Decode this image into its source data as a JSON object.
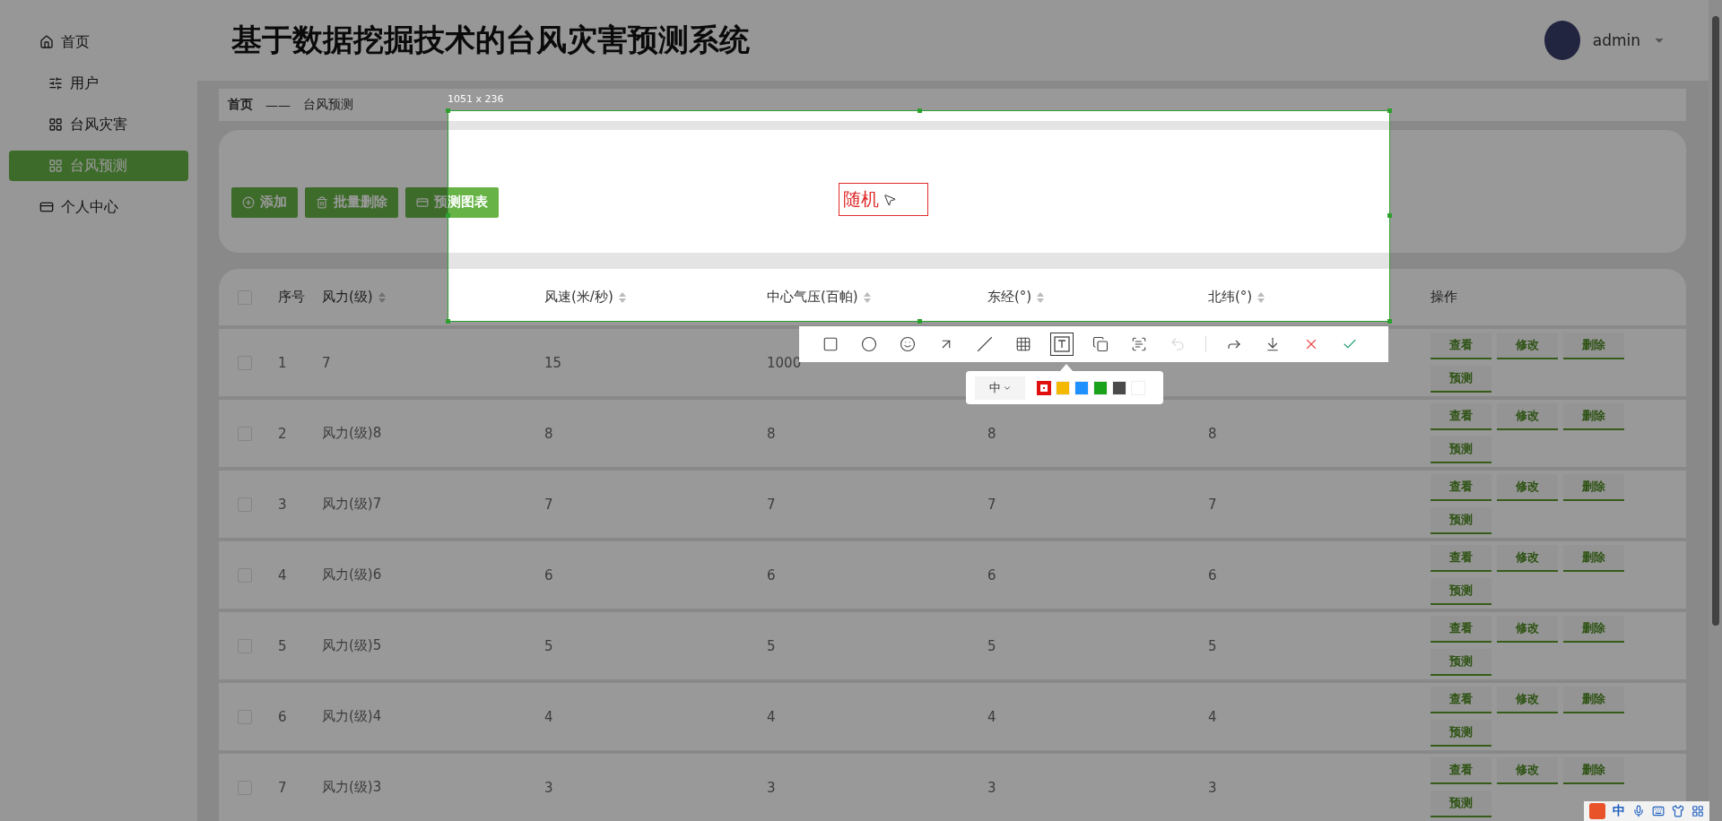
{
  "sidebar": {
    "items": [
      {
        "label": "首页",
        "kind": "top",
        "selected": false
      },
      {
        "label": "用户",
        "kind": "sub",
        "selected": false
      },
      {
        "label": "台风灾害",
        "kind": "sub",
        "selected": false
      },
      {
        "label": "台风预测",
        "kind": "sub",
        "selected": true
      },
      {
        "label": "个人中心",
        "kind": "top",
        "selected": false
      }
    ]
  },
  "header": {
    "title": "基于数据挖掘技术的台风灾害预测系统",
    "user": "admin"
  },
  "breadcrumb": {
    "items": [
      "首页",
      "台风预测"
    ],
    "separator": "——"
  },
  "actions": [
    {
      "label": "添加",
      "kind": "add"
    },
    {
      "label": "批量删除",
      "kind": "delete"
    },
    {
      "label": "预测图表",
      "kind": "chart"
    }
  ],
  "table": {
    "select_all": {
      "checked": false
    },
    "columns": [
      {
        "label": "序号",
        "sortable": false
      },
      {
        "label": "风力(级)",
        "sortable": true
      },
      {
        "label": "风速(米/秒)",
        "sortable": true
      },
      {
        "label": "中心气压(百帕)",
        "sortable": true
      },
      {
        "label": "东经(°)",
        "sortable": true
      },
      {
        "label": "北纬(°)",
        "sortable": true
      },
      {
        "label": "操作",
        "sortable": false
      }
    ],
    "rows": [
      {
        "checked": false,
        "cells": [
          "1",
          "7",
          "15",
          "1000"
        ],
        "buttons": [
          "查看",
          "修改",
          "删除",
          "预测"
        ]
      },
      {
        "checked": false,
        "cells": [
          "2",
          "风力(级)8",
          "8",
          "8",
          "8",
          "8"
        ],
        "buttons": [
          "查看",
          "修改",
          "删除",
          "预测"
        ]
      },
      {
        "checked": false,
        "cells": [
          "3",
          "风力(级)7",
          "7",
          "7",
          "7",
          "7"
        ],
        "buttons": [
          "查看",
          "修改",
          "删除",
          "预测"
        ]
      },
      {
        "checked": false,
        "cells": [
          "4",
          "风力(级)6",
          "6",
          "6",
          "6",
          "6"
        ],
        "buttons": [
          "查看",
          "修改",
          "删除",
          "预测"
        ]
      },
      {
        "checked": false,
        "cells": [
          "5",
          "风力(级)5",
          "5",
          "5",
          "5",
          "5"
        ],
        "buttons": [
          "查看",
          "修改",
          "删除",
          "预测"
        ]
      },
      {
        "checked": false,
        "cells": [
          "6",
          "风力(级)4",
          "4",
          "4",
          "4",
          "4"
        ],
        "buttons": [
          "查看",
          "修改",
          "删除",
          "预测"
        ]
      },
      {
        "checked": false,
        "cells": [
          "7",
          "风力(级)3",
          "3",
          "3",
          "3",
          "3"
        ],
        "buttons": [
          "查看",
          "修改",
          "删除",
          "预测"
        ]
      }
    ]
  },
  "capture": {
    "size_label": "1051 x 236",
    "annotation": {
      "text": "随机",
      "color": "#e02a2a"
    },
    "tools": [
      {
        "kind": "rect",
        "selected": false,
        "disabled": false
      },
      {
        "kind": "ellipse",
        "selected": false,
        "disabled": false
      },
      {
        "kind": "emoji",
        "selected": false,
        "disabled": false
      },
      {
        "kind": "arrow",
        "selected": false,
        "disabled": false
      },
      {
        "kind": "pen",
        "selected": false,
        "disabled": false
      },
      {
        "kind": "mosaic",
        "selected": false,
        "disabled": false
      },
      {
        "kind": "text",
        "selected": true,
        "disabled": false
      },
      {
        "kind": "pin",
        "selected": false,
        "disabled": false
      },
      {
        "kind": "ocr",
        "selected": false,
        "disabled": false
      },
      {
        "kind": "undo",
        "selected": false,
        "disabled": true
      },
      {
        "kind": "share",
        "selected": false,
        "disabled": false
      },
      {
        "kind": "save",
        "selected": false,
        "disabled": false
      },
      {
        "kind": "cancel",
        "selected": false,
        "disabled": false
      },
      {
        "kind": "confirm",
        "selected": false,
        "disabled": false
      }
    ],
    "font_size": "中",
    "colors": [
      {
        "color": "#e01010",
        "selected": true
      },
      {
        "color": "#f5b800",
        "selected": false
      },
      {
        "color": "#1e90ff",
        "selected": false
      },
      {
        "color": "#1aa31a",
        "selected": false
      },
      {
        "color": "#4a4a4a",
        "selected": false
      },
      {
        "color": "#ffffff",
        "selected": false
      }
    ]
  },
  "ime": {
    "label": "中"
  }
}
